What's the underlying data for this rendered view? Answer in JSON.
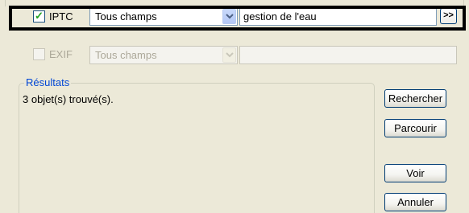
{
  "rows": [
    {
      "checkbox_label": "IPTC",
      "checked": true,
      "field_combo": "Tous champs",
      "search_value": "gestion de l'eau",
      "more_button": ">>"
    },
    {
      "checkbox_label": "EXIF",
      "checked": false,
      "field_combo": "Tous champs",
      "search_value": ""
    }
  ],
  "results": {
    "title": "Résultats",
    "status": "3 objet(s) trouvé(s)."
  },
  "buttons": {
    "search": "Rechercher",
    "browse": "Parcourir",
    "view": "Voir",
    "cancel": "Annuler"
  },
  "icons": {
    "check": "check-icon",
    "dropdown": "chevron-down-icon"
  },
  "colors": {
    "window_bg": "#ece9d8",
    "group_title": "#0046d5",
    "checkmark": "#21a121",
    "highlight_border": "#000000"
  }
}
